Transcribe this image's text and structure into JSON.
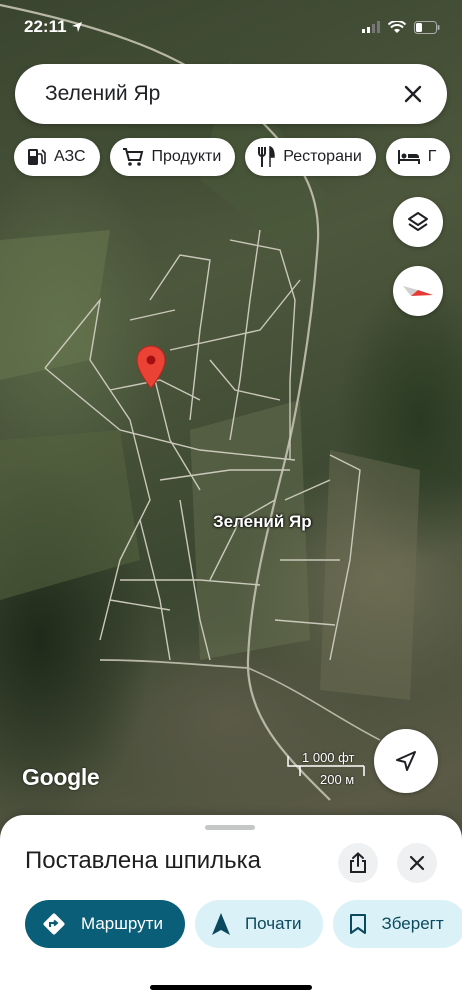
{
  "status_bar": {
    "time": "22:11"
  },
  "search": {
    "query": "Зелений Яр"
  },
  "chips": [
    {
      "label": "АЗС",
      "icon": "gas-station-icon"
    },
    {
      "label": "Продукти",
      "icon": "cart-icon"
    },
    {
      "label": "Ресторани",
      "icon": "restaurant-icon"
    },
    {
      "label": "Г",
      "icon": "hotel-icon"
    }
  ],
  "map": {
    "place_label": "Зелений Яр",
    "logo": "Google",
    "scale_imperial": "1 000 фт",
    "scale_metric": "200 м",
    "pin_color": "#ea4335"
  },
  "sheet": {
    "title": "Поставлена шпилька",
    "actions": [
      {
        "label": "Маршрути",
        "icon": "directions-icon"
      },
      {
        "label": "Почати",
        "icon": "navigation-arrow-icon"
      },
      {
        "label": "Зберегт",
        "icon": "bookmark-icon"
      }
    ]
  },
  "colors": {
    "primary_action": "#0b5e77",
    "secondary_action": "#d9f1f7"
  }
}
